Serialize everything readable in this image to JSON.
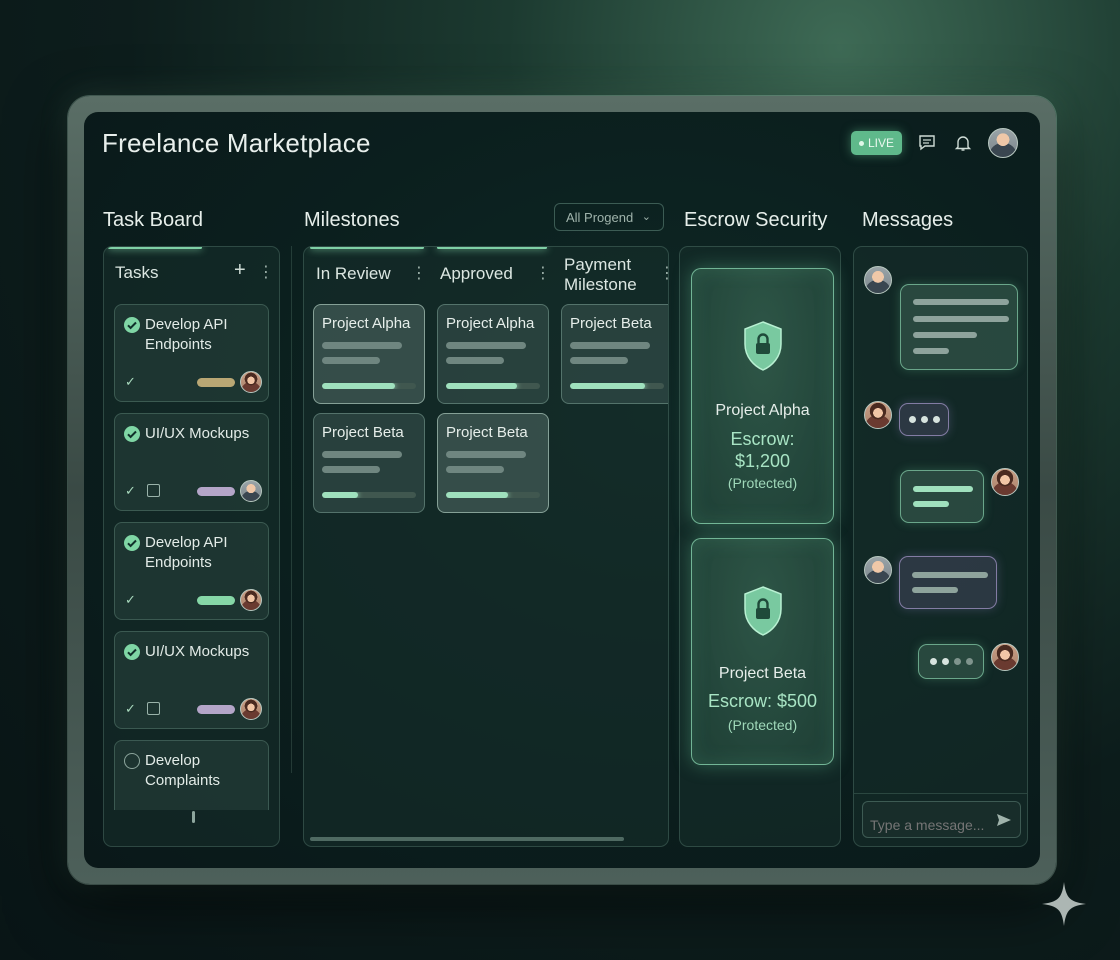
{
  "app": {
    "title": "Freelance Marketplace",
    "live_label": "LIVE"
  },
  "header": {
    "icons": [
      "message-icon",
      "bell-icon"
    ],
    "avatar": "user-avatar"
  },
  "task_board": {
    "section_title": "Task Board",
    "list_title": "Tasks",
    "cards": [
      {
        "title": "Develop API Endpoints",
        "done": true,
        "pill_color": "#b9a774"
      },
      {
        "title": "UI/UX Mockups",
        "done": true,
        "pill_color": "#b4a5c8"
      },
      {
        "title": "Develop API Endpoints",
        "done": true,
        "pill_color": "#86d7a7"
      },
      {
        "title": "UI/UX Mockups",
        "done": true,
        "pill_color": "#b4a5c8"
      },
      {
        "title": "Develop Complaints",
        "done": false
      }
    ]
  },
  "milestones": {
    "section_title": "Milestones",
    "filter": "All Progend",
    "columns": [
      {
        "title": "In Review",
        "cards": [
          {
            "title": "Project Alpha",
            "progress": 0.78
          },
          {
            "title": "Project Beta",
            "progress": 0.38
          }
        ]
      },
      {
        "title": "Approved",
        "cards": [
          {
            "title": "Project Alpha",
            "progress": 0.76
          },
          {
            "title": "Project Beta",
            "progress": 0.66
          }
        ]
      },
      {
        "title": "Payment Milestone",
        "cards": [
          {
            "title": "Project Beta",
            "progress": 0.8
          }
        ]
      }
    ]
  },
  "escrow": {
    "section_title": "Escrow Security",
    "cards": [
      {
        "project": "Project Alpha",
        "amount_line1": "Escrow:",
        "amount_line2": "$1,200",
        "status": "(Protected)"
      },
      {
        "project": "Project Beta",
        "amount_line1": "Escrow: $500",
        "status": "(Protected)"
      }
    ]
  },
  "messages": {
    "section_title": "Messages",
    "input_placeholder": "Type a message..."
  },
  "colors": {
    "accent": "#7fd0a6",
    "background": "#0b1f1e",
    "live_badge": "#5fb98b"
  }
}
